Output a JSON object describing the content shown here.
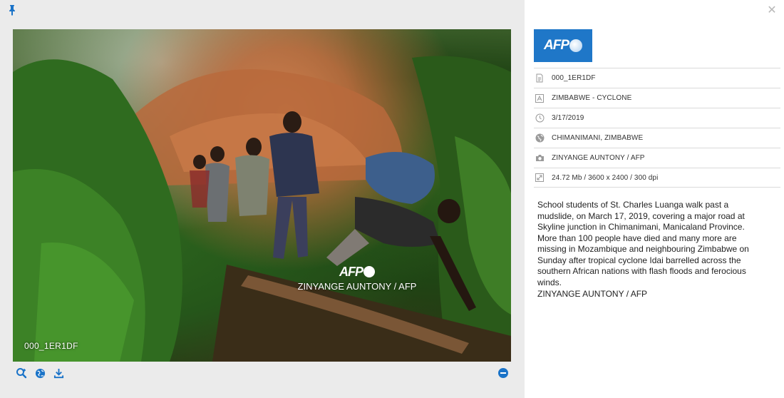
{
  "viewer": {
    "photo_id_overlay": "000_1ER1DF",
    "watermark_logo": "AFP",
    "watermark_credit": "ZINYANGE AUNTONY / AFP",
    "toolbar_icons": [
      "zoom-in-icon",
      "globe-icon",
      "download-icon"
    ],
    "accent_color": "#1a73c8"
  },
  "panel": {
    "logo_text": "AFP",
    "logo_color": "#1f77c8",
    "meta": [
      {
        "icon": "file-icon",
        "text": "000_1ER1DF"
      },
      {
        "icon": "title-icon",
        "text": "ZIMBABWE - CYCLONE"
      },
      {
        "icon": "clock-icon",
        "text": "3/17/2019"
      },
      {
        "icon": "globe-icon",
        "text": "CHIMANIMANI, ZIMBABWE"
      },
      {
        "icon": "camera-icon",
        "text": "ZINYANGE AUNTONY / AFP"
      },
      {
        "icon": "resize-icon",
        "text": "24.72 Mb / 3600 x 2400 / 300 dpi"
      }
    ],
    "caption": "School students of St. Charles Luanga walk past a mudslide, on March 17, 2019, covering a major road at Skyline junction in Chimanimani, Manicaland Province. More than 100 people have died and many more are missing in Mozambique and neighbouring Zimbabwe on Sunday after tropical cyclone Idai barrelled across the southern African nations with flash floods and ferocious winds.",
    "caption_credit": "ZINYANGE AUNTONY / AFP"
  }
}
